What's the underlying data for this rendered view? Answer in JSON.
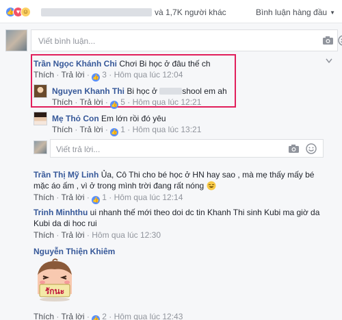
{
  "reactions": {
    "icons": [
      "like-icon",
      "love-icon",
      "haha-icon"
    ],
    "count_text": "và 1,7K người khác",
    "sort_label": "Bình luận hàng đầu"
  },
  "compose": {
    "placeholder": "Viết bình luận..."
  },
  "reply_box": {
    "placeholder": "Viết trả lời..."
  },
  "comments": [
    {
      "name": "Trần Ngọc Khánh Chi",
      "text": "Chơi Bi học ở đâu thế ch",
      "like_label": "Thích",
      "reply_label": "Trả lời",
      "likes": "3",
      "time": "Hôm qua lúc 12:04"
    },
    {
      "name": "Nguyen Khanh Thi",
      "text_before": "Bi học ở",
      "text_after": "shool em ah",
      "like_label": "Thích",
      "reply_label": "Trả lời",
      "likes": "5",
      "time": "Hôm qua lúc 12:21"
    },
    {
      "name": "Mẹ Thỏ Con",
      "text": "Em lớn rồi đó yêu",
      "like_label": "Thích",
      "reply_label": "Trả lời",
      "likes": "1",
      "time": "Hôm qua lúc 13:21"
    },
    {
      "name": "Trần Thị Mỹ Linh",
      "text_line1": "Ủa, Cô Thi cho bé học ở HN hay sao , mà mẹ thấy mấy bé",
      "text_line2": "mặc áo ấm , vì ở trong mình trời đang rất nóng",
      "like_label": "Thích",
      "reply_label": "Trả lời",
      "likes": "1",
      "time": "Hôm qua lúc 12:14"
    },
    {
      "name": "Trinh Minhthu",
      "text_line1": "ui nhanh thế mới theo doi dc tin Khanh Thi sinh Kubi ma giờ da",
      "text_line2": "Kubi da di hoc rui",
      "like_label": "Thích",
      "reply_label": "Trả lời",
      "time": "Hôm qua lúc 12:30"
    },
    {
      "name": "Nguyễn Thiện Khiêm",
      "sticker_text": "รักนะ",
      "like_label": "Thích",
      "reply_label": "Trả lời",
      "likes": "2",
      "time": "Hôm qua lúc 12:43"
    }
  ],
  "sep": "·"
}
